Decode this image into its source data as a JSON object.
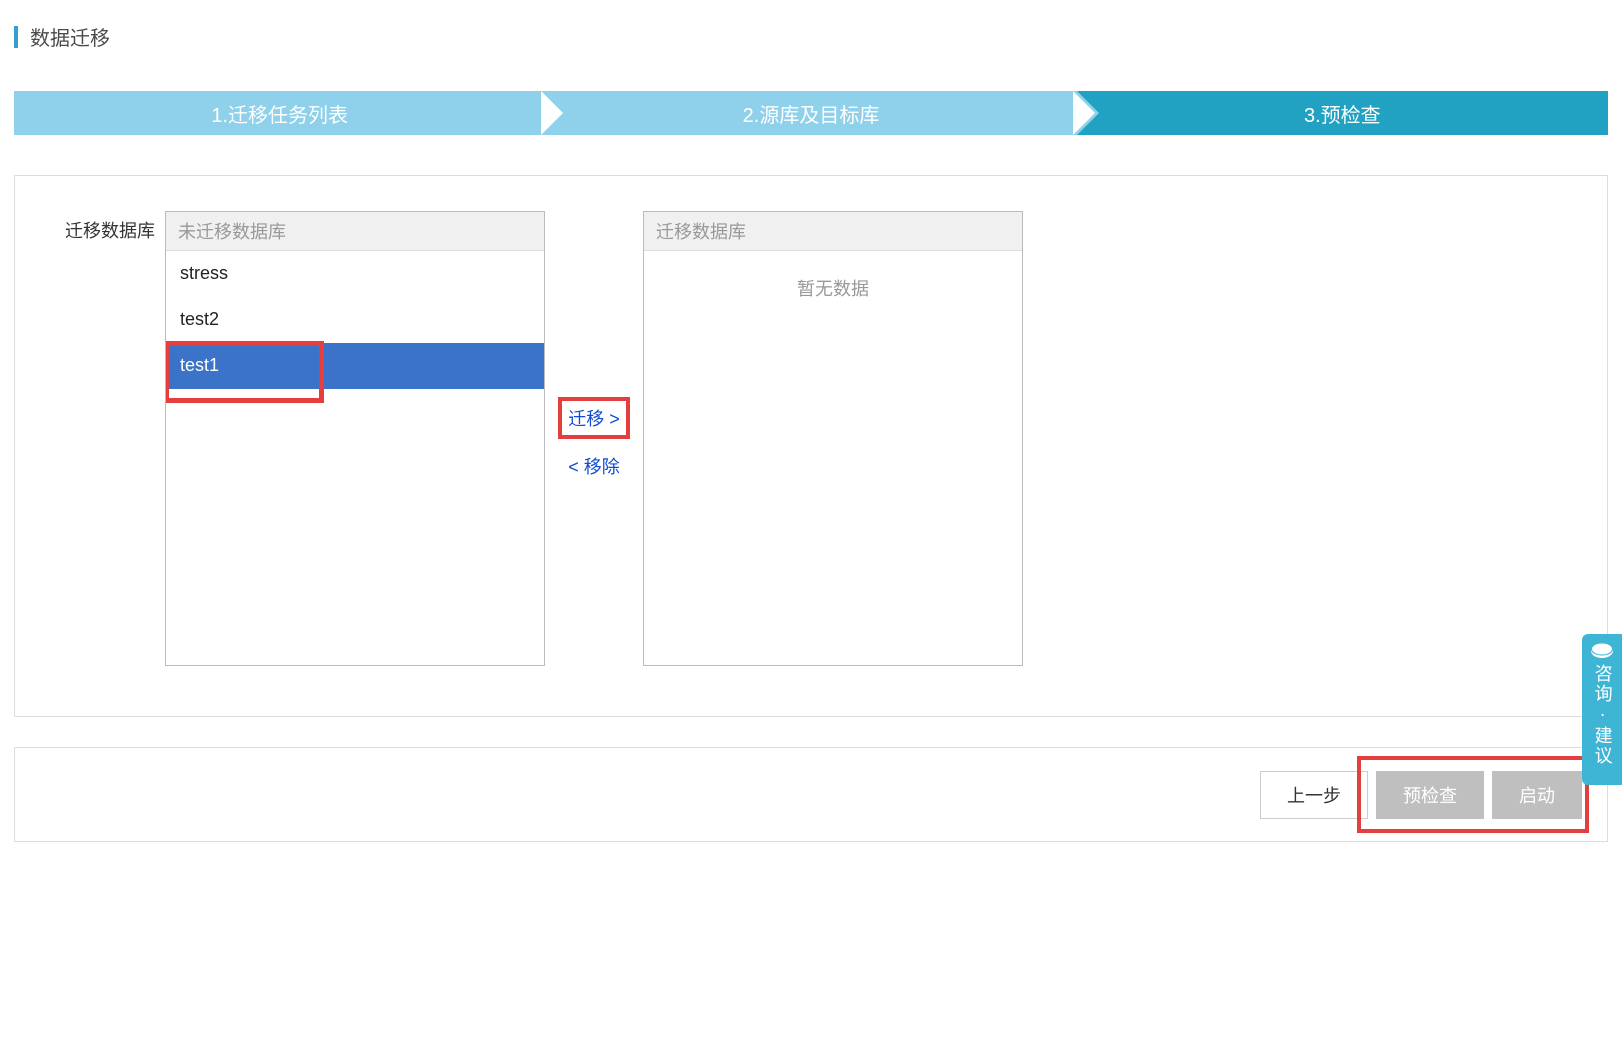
{
  "page_title": "数据迁移",
  "stepper": {
    "steps": [
      {
        "label": "1.迁移任务列表",
        "style": "light"
      },
      {
        "label": "2.源库及目标库",
        "style": "light"
      },
      {
        "label": "3.预检查",
        "style": "dark"
      }
    ]
  },
  "content": {
    "label": "迁移数据库",
    "source_list": {
      "header": "未迁移数据库",
      "items": [
        {
          "label": "stress",
          "selected": false
        },
        {
          "label": "test2",
          "selected": false
        },
        {
          "label": "test1",
          "selected": true
        }
      ]
    },
    "transfer_buttons": {
      "move_right": "迁移 >",
      "move_left": "< 移除"
    },
    "target_list": {
      "header": "迁移数据库",
      "empty_text": "暂无数据",
      "items": []
    }
  },
  "footer": {
    "prev": "上一步",
    "precheck": "预检查",
    "start": "启动"
  },
  "side_tab": {
    "text": "咨询·建议"
  }
}
